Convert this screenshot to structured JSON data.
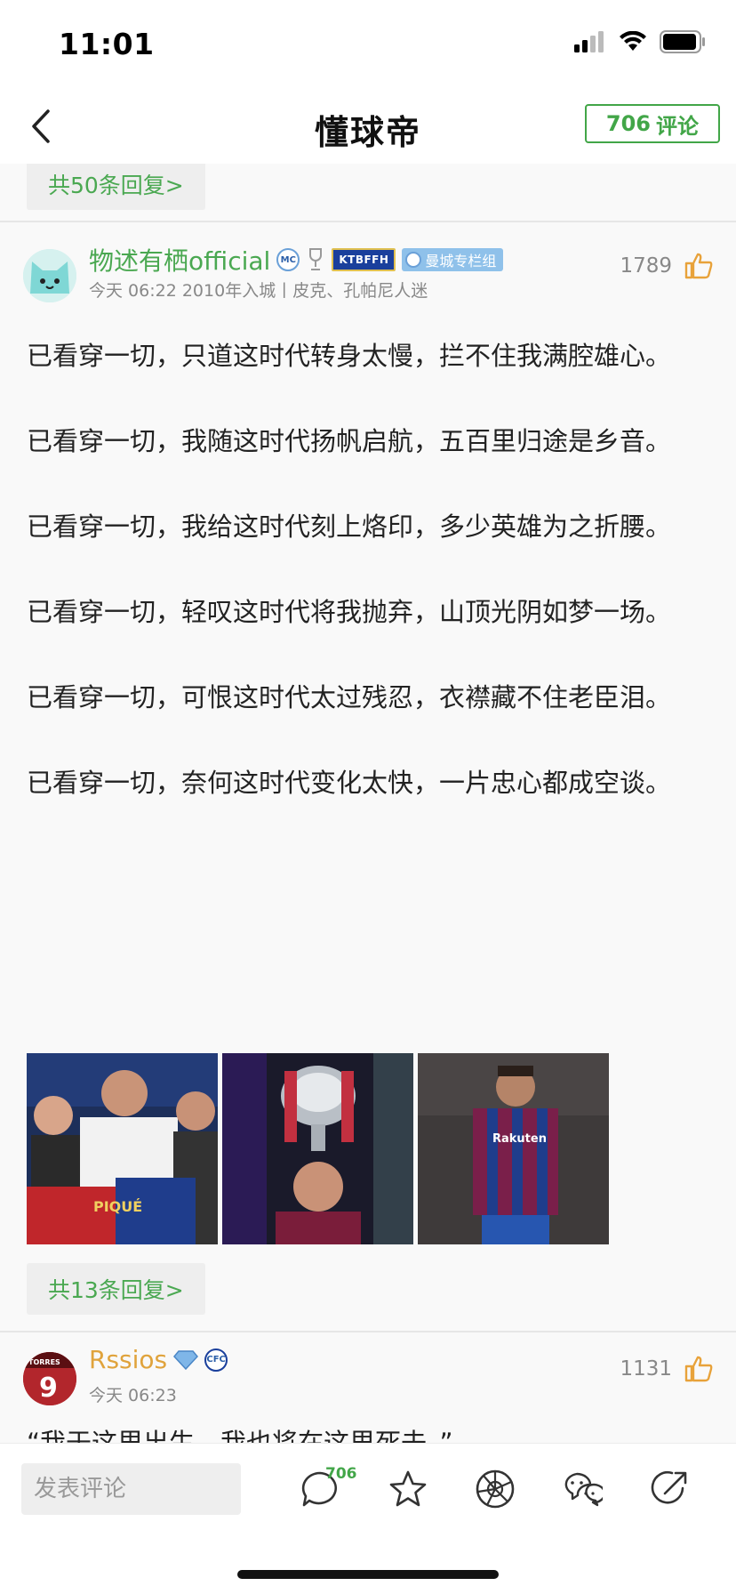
{
  "status_bar": {
    "time": "11:01"
  },
  "nav": {
    "title": "懂球帝",
    "comment_count": "706",
    "comment_label": "评论"
  },
  "top_reply": {
    "label": "共50条回复>"
  },
  "comments": [
    {
      "username": "物述有栖official",
      "username_color": "#4aa851",
      "badges": [
        "KTBFFH",
        "曼城专栏组"
      ],
      "meta": "今天 06:22 2010年入城丨皮克、孔帕尼人迷",
      "likes": "1789",
      "paragraphs": [
        "已看穿一切，只道这时代转身太慢，拦不住我满腔雄心。",
        "已看穿一切，我随这时代扬帆启航，五百里归途是乡音。",
        "已看穿一切，我给这时代刻上烙印，多少英雄为之折腰。",
        "已看穿一切，轻叹这时代将我抛弃，山顶光阴如梦一场。",
        "已看穿一切，可恨这时代太过残忍，衣襟藏不住老臣泪。",
        "已看穿一切，奈何这时代变化太快，一片忠心都成空谈。"
      ],
      "image_captions": [
        "PIQUÉ",
        "Rakuten"
      ],
      "reply_label": "共13条回复>"
    },
    {
      "username": "Rssios",
      "username_color": "#e0a33c",
      "avatar_text": "TORRES",
      "avatar_number": "9",
      "meta": "今天 06:23",
      "likes": "1131",
      "text": "“我于这里出生，我也将在这里死去。”"
    }
  ],
  "bottom_bar": {
    "input_placeholder": "发表评论",
    "comment_badge": "706"
  },
  "colors": {
    "accent_green": "#42a648",
    "like_orange": "#e8a23a"
  }
}
